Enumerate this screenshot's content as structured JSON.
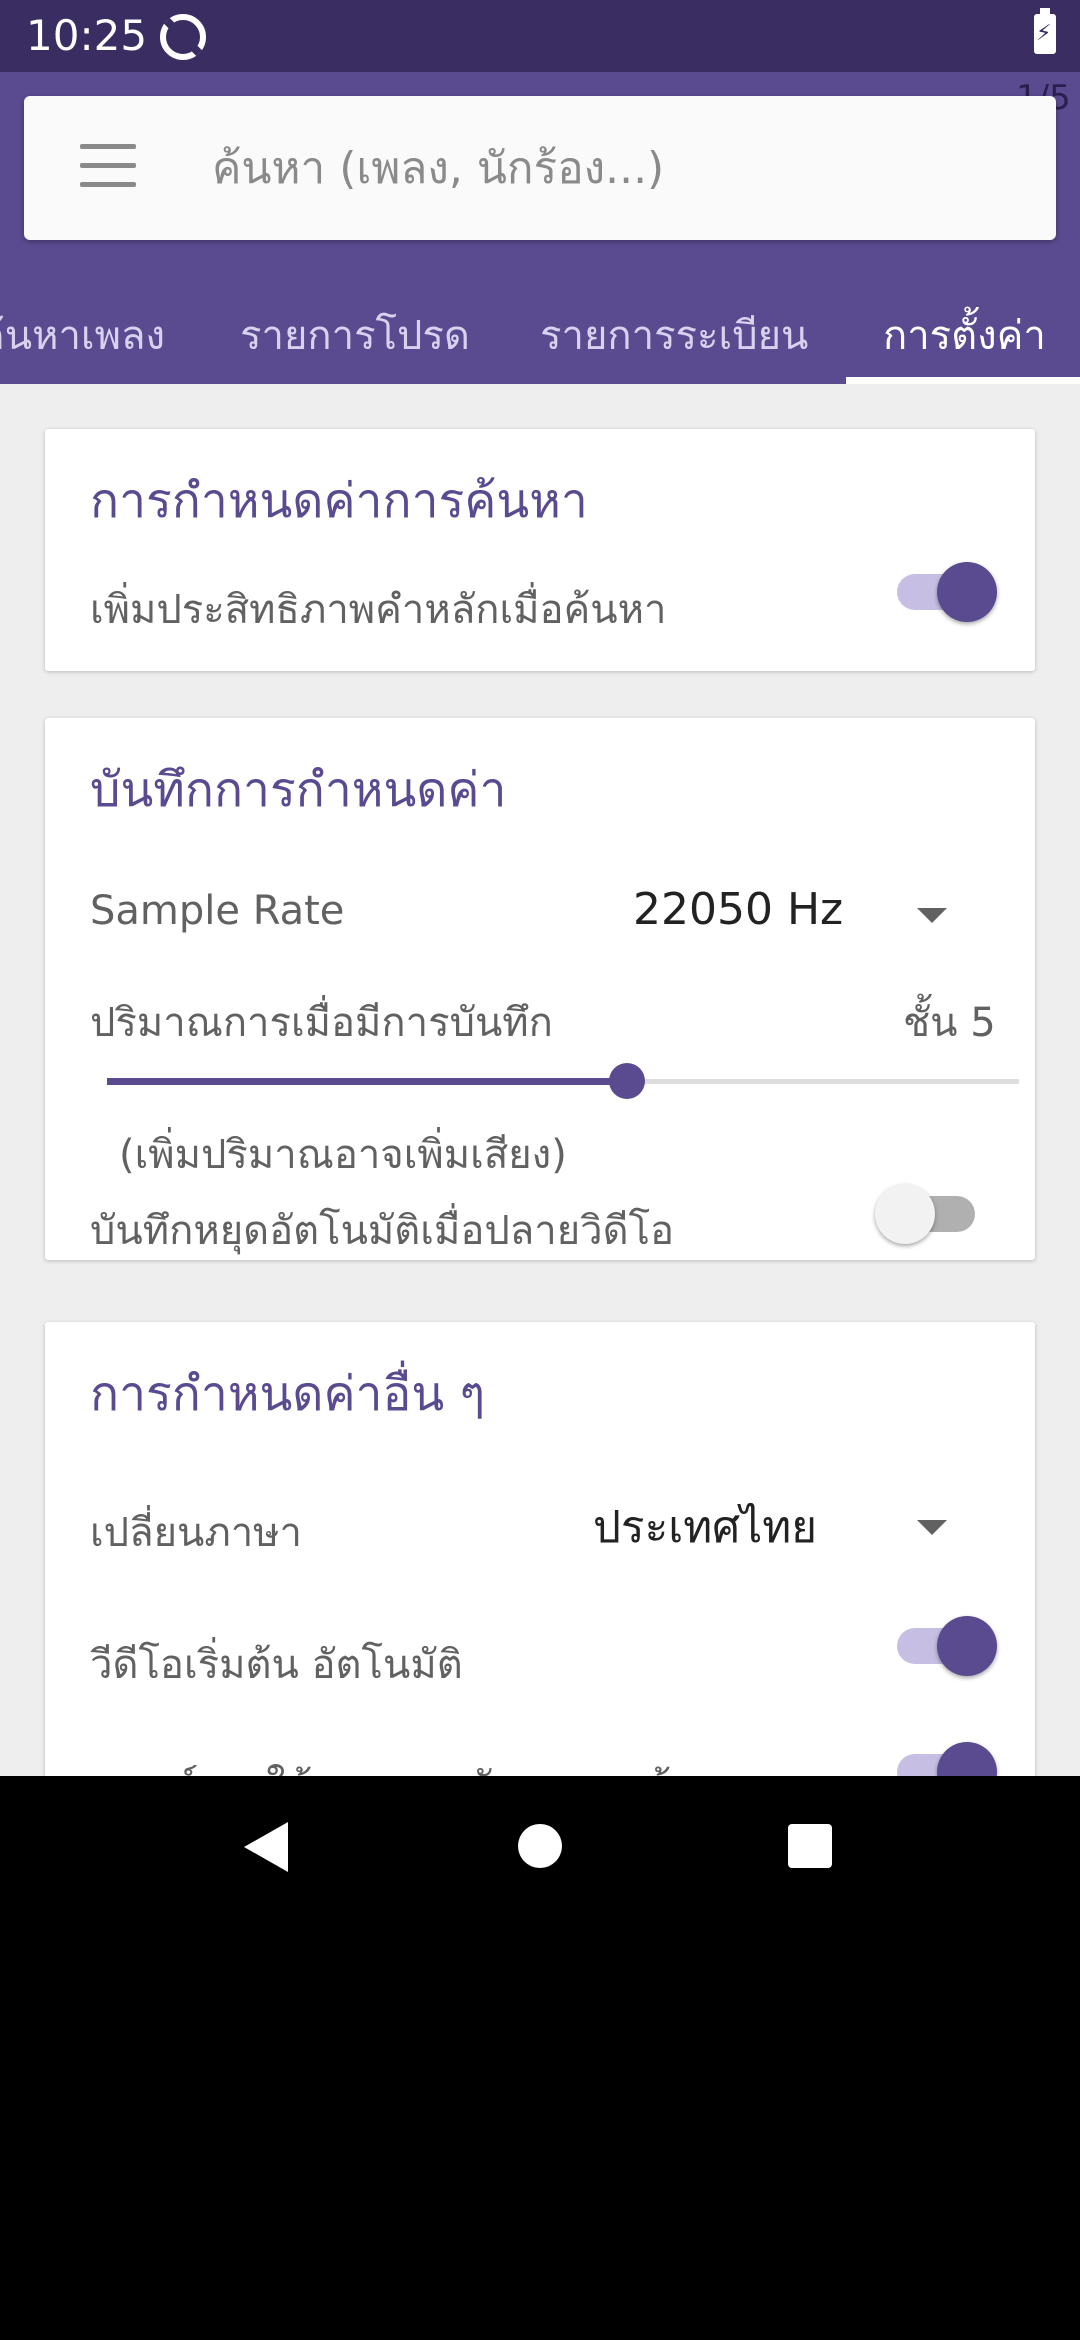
{
  "status_bar": {
    "time": "10:25",
    "battery_icon": "battery-charging-icon",
    "app_icon": "sync-app-icon"
  },
  "page_indicator": "1/5",
  "search": {
    "placeholder": "ค้นหา (เพลง, นักร้อง...)",
    "menu_icon": "hamburger-menu-icon"
  },
  "tabs": [
    {
      "label": "ค้นหาเพลง",
      "active": false
    },
    {
      "label": "รายการโปรด",
      "active": false
    },
    {
      "label": "รายการระเบียน",
      "active": false
    },
    {
      "label": "การตั้งค่า",
      "active": true
    }
  ],
  "search_settings": {
    "title": "การกำหนดค่าการค้นหา",
    "keyword_boost_label": "เพิ่มประสิทธิภาพคำหลักเมื่อค้นหา",
    "keyword_boost_on": true
  },
  "record_settings": {
    "title": "บันทึกการกำหนดค่า",
    "sample_rate_label": "Sample Rate",
    "sample_rate_value": "22050 Hz",
    "volume_label": "ปริมาณการเมื่อมีการบันทึก",
    "volume_value": "ชั้น 5",
    "volume_slider_fraction": 0.57,
    "volume_hint": "(เพิ่มปริมาณอาจเพิ่มเสียง)",
    "auto_stop_label": "บันทึกหยุดอัตโนมัติเมื่อปลายวิดีโอ",
    "auto_stop_on": false
  },
  "other_settings": {
    "title": "การกำหนดค่าอื่น ๆ",
    "language_label": "เปลี่ยนภาษา",
    "language_value": "ประเทศไทย",
    "autoplay_label": "วีดีโอเริ่มต้น อัตโนมัติ",
    "autoplay_on": true,
    "score_label": "เกณฑ์การให้คะแนนหลังจากการร้อง",
    "score_on": true
  },
  "colors": {
    "primary": "#5a4b91",
    "status_bar": "#3a2d62",
    "switch_track_on": "#c6bfe3"
  }
}
